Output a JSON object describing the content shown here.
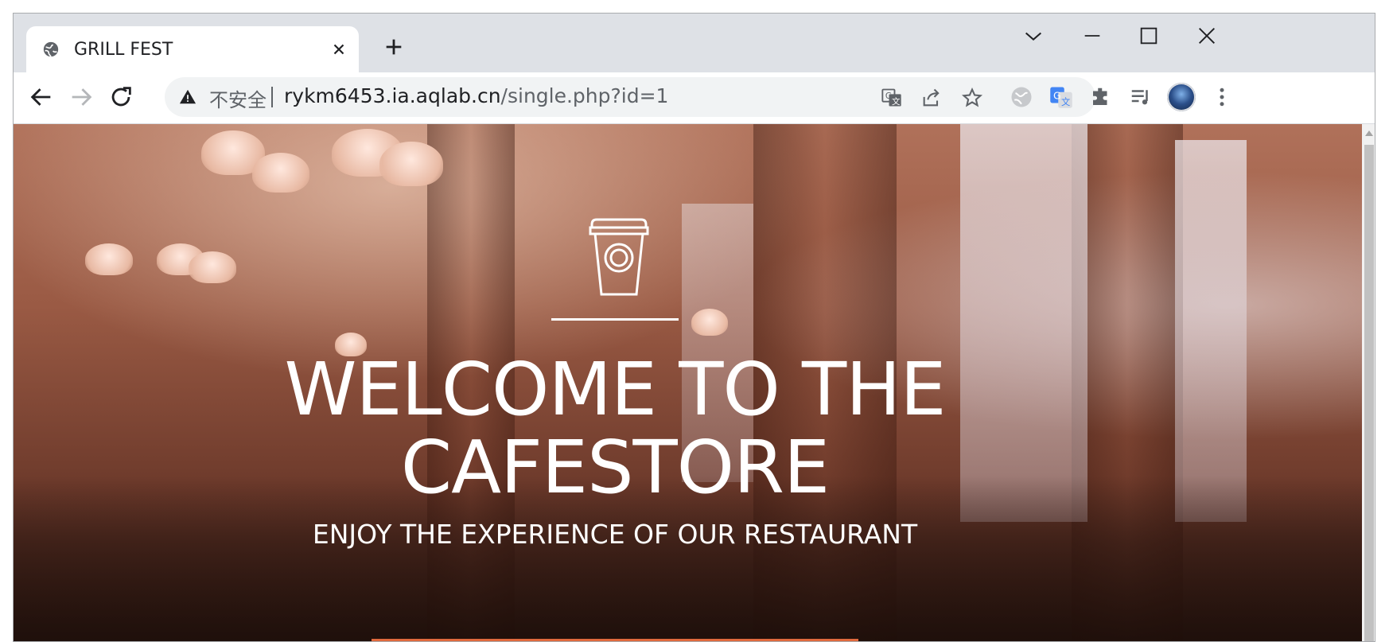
{
  "tab": {
    "title": "GRILL FEST"
  },
  "omnibox": {
    "security_label": "不安全",
    "url_host": "rykm6453.ia.aqlab.cn",
    "url_path": "/single.php?id=1"
  },
  "hero": {
    "title_line1": "WELCOME TO THE",
    "title_line2": "CAFESTORE",
    "subtitle": "ENJOY THE EXPERIENCE OF OUR RESTAURANT",
    "icon": "coffee-cup-icon"
  },
  "colors": {
    "accent": "#e0693d",
    "tab_strip": "#dee1e6",
    "omnibox_bg": "#f1f3f4"
  }
}
